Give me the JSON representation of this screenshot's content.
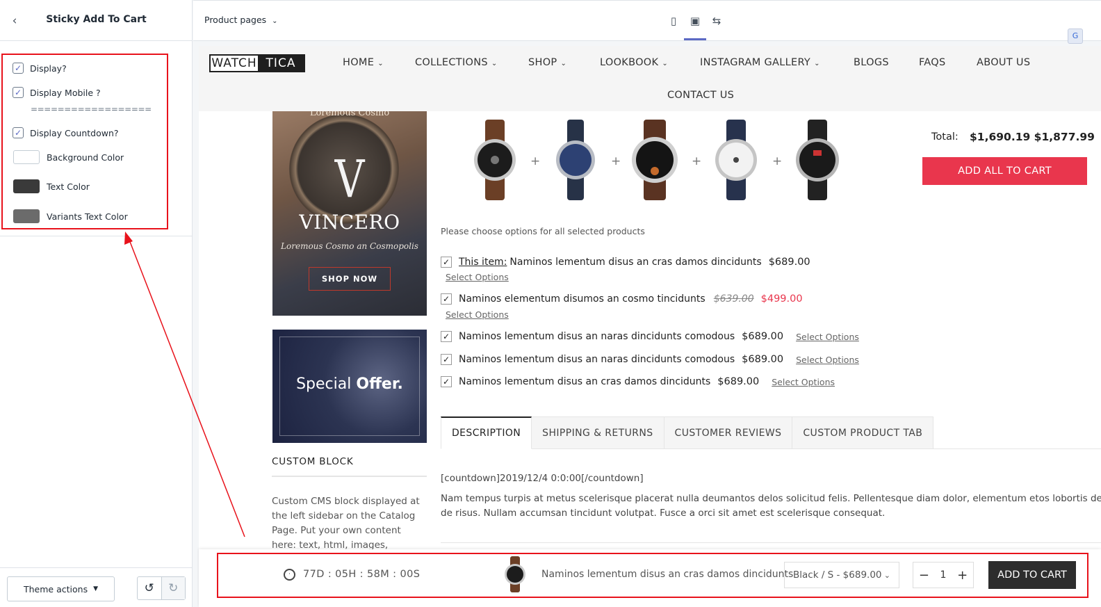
{
  "editor": {
    "title": "Sticky Add To Cart",
    "settings": {
      "display": {
        "label": "Display?",
        "checked": true
      },
      "display_mobile": {
        "label": "Display Mobile ?",
        "checked": true
      },
      "separator": "==================",
      "display_countdown": {
        "label": "Display Countdown?",
        "checked": true
      },
      "background_color": {
        "label": "Background Color",
        "value": "#ffffff"
      },
      "text_color": {
        "label": "Text Color",
        "value": "#3a3a3a"
      },
      "variants_text_color": {
        "label": "Variants Text Color",
        "value": "#6b6b6b"
      }
    },
    "footer": {
      "theme_actions": "Theme actions"
    }
  },
  "toolbar": {
    "page_select": "Product pages",
    "devices": [
      "mobile-icon",
      "desktop-icon",
      "fullscreen-icon"
    ],
    "active_device": "desktop-icon"
  },
  "store": {
    "logo_left": "WATCH",
    "logo_right": "TICA",
    "nav": {
      "home": "HOME",
      "collections": "COLLECTIONS",
      "shop": "SHOP",
      "lookbook": "LOOKBOOK",
      "instagram": "INSTAGRAM GALLERY",
      "blogs": "BLOGS",
      "faqs": "FAQS",
      "about": "ABOUT US",
      "contact": "CONTACT US"
    },
    "banner1": {
      "top": "Loremous Cosmo",
      "brand": "VINCERO",
      "subtitle": "Loremous Cosmo an Cosmopolis",
      "button": "SHOP NOW"
    },
    "banner2": {
      "text1": "Special",
      "text2": "Offer."
    },
    "custom_block": {
      "title": "CUSTOM BLOCK",
      "text": "Custom CMS block displayed at the left sidebar on the Catalog Page. Put your own content here: text, html, images, media..."
    },
    "bundle": {
      "total_label": "Total:",
      "total_value": "$1,690.19 $1,877.99",
      "add_all": "ADD ALL TO CART",
      "note": "Please choose options for all selected products",
      "plus": "+",
      "items": [
        {
          "prefix": "This item:",
          "name": "Naminos lementum disus an cras damos dincidunts",
          "price": "$689.00",
          "options": "Select Options"
        },
        {
          "name": "Naminos elementum disumos an cosmo tincidunts",
          "old_price": "$639.00",
          "price": "$499.00",
          "options": "Select Options"
        },
        {
          "name": "Naminos lementum disus an naras dincidunts comodous",
          "price": "$689.00",
          "options": "Select Options"
        },
        {
          "name": "Naminos lementum disus an naras dincidunts comodous",
          "price": "$689.00",
          "options": "Select Options"
        },
        {
          "name": "Naminos lementum disus an cras damos dincidunts",
          "price": "$689.00",
          "options": "Select Options"
        }
      ]
    },
    "tabs": [
      "DESCRIPTION",
      "SHIPPING & RETURNS",
      "CUSTOMER REVIEWS",
      "CUSTOM PRODUCT TAB"
    ],
    "description": {
      "code": "[countdown]2019/12/4 0:0:00[/countdown]",
      "line1": "Nam tempus turpis at metus scelerisque placerat nulla deumantos delos solicitud felis. Pellentesque diam dolor, elementum etos lobortis des mollis",
      "line2": "de risus. Nullam accumsan tincidunt volutpat. Fusce a orci sit amet est scelerisque consequat."
    },
    "sticky": {
      "countdown": "77D : 05H : 58M : 00S",
      "product": "Naminos lementum disus an cras damos dincidunts",
      "variant": "Black / S - $689.00",
      "qty": "1",
      "add": "ADD TO CART"
    }
  },
  "colors": {
    "accent": "#5c6ac4",
    "cta": "#e9364d",
    "highlight": "#e8121b",
    "sticky_button": "#2d2d2d"
  }
}
